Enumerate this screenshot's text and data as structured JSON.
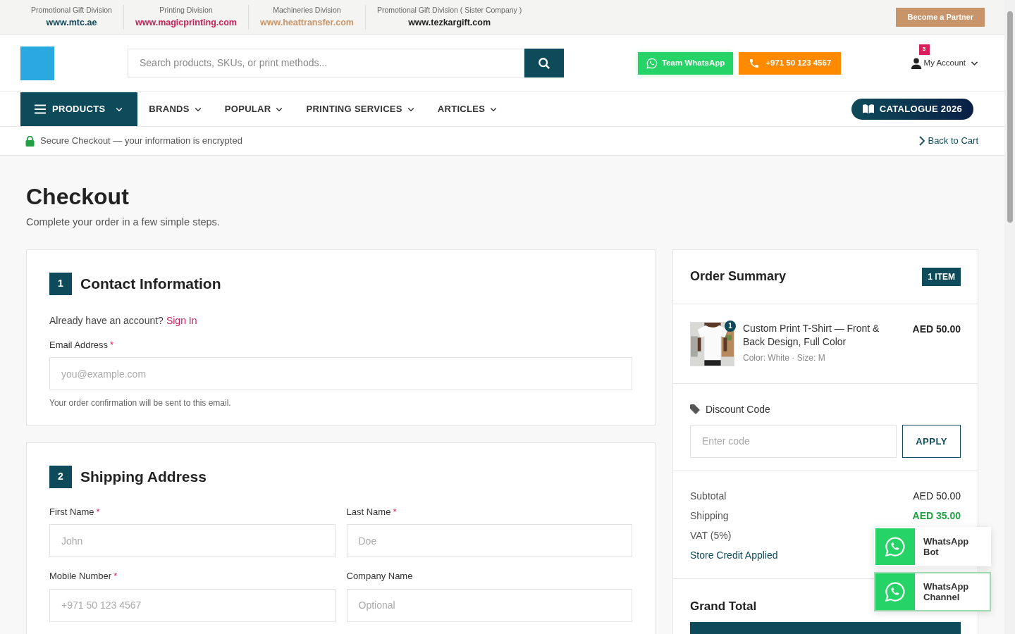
{
  "top_bar": {
    "divisions": [
      {
        "label": "Promotional Gift Division",
        "url": "www.mtc.ae",
        "color": "#144a5c"
      },
      {
        "label": "Printing Division",
        "url": "www.magicprinting.com",
        "color": "#c8205a"
      },
      {
        "label": "Machineries Division",
        "url": "www.heattransfer.com",
        "color": "#c8956a"
      },
      {
        "label": "Promotional Gift Division ( Sister Company )",
        "url": "www.tezkargift.com",
        "color": "#222222"
      }
    ],
    "partner_button": "Become a Partner"
  },
  "header": {
    "search": {
      "placeholder": "Search products, SKUs, or print methods..."
    },
    "whatsapp_button": "Team WhatsApp",
    "phone_button": "+971 50 123 4567",
    "account": {
      "label": "My Account",
      "badge": "5"
    }
  },
  "nav": {
    "items": [
      {
        "label": "PRODUCTS",
        "selected": true
      },
      {
        "label": "BRANDS",
        "selected": false
      },
      {
        "label": "POPULAR",
        "selected": false
      },
      {
        "label": "PRINTING SERVICES",
        "selected": false
      },
      {
        "label": "ARTICLES",
        "selected": false
      }
    ],
    "catalogue_button": "CATALOGUE 2026"
  },
  "secure_bar": {
    "text": "Secure Checkout — your information is encrypted",
    "back_link": "Back to Cart"
  },
  "page": {
    "title": "Checkout",
    "subtitle": "Complete your order in a few simple steps."
  },
  "contact": {
    "number": "1",
    "title": "Contact Information",
    "prompt": "Already have an account?",
    "sign_in": "Sign In",
    "email": {
      "label": "Email Address",
      "required_mark": "*",
      "placeholder": "you@example.com",
      "hint": "Your order confirmation will be sent to this email."
    }
  },
  "shipping": {
    "number": "2",
    "title": "Shipping Address",
    "fields": [
      {
        "label": "First Name",
        "required_mark": "*",
        "placeholder": "John"
      },
      {
        "label": "Last Name",
        "required_mark": "*",
        "placeholder": "Doe"
      },
      {
        "label": "Mobile Number",
        "required_mark": "*",
        "placeholder": "+971 50 123 4567"
      },
      {
        "label": "Company Name",
        "placeholder": "Optional"
      }
    ]
  },
  "summary": {
    "title": "Order Summary",
    "badge": "1 ITEM",
    "item": {
      "kind": "picture",
      "quantity": "1",
      "name": "Custom Print T-Shirt — Front & Back Design, Full Color",
      "variant": "Color: White · Size: M",
      "price": "AED 50.00"
    },
    "discount": {
      "label": "Discount Code",
      "placeholder": "Enter code",
      "button": "APPLY"
    },
    "totals": [
      {
        "label": "Subtotal",
        "value": "AED 50.00"
      },
      {
        "label": "Shipping",
        "value": "AED 35.00",
        "highlight": true
      },
      {
        "label": "VAT (5%)"
      },
      {
        "label": "Store Credit Applied",
        "link": true
      }
    ],
    "grand_total": "Grand Total"
  },
  "floating": [
    {
      "label": "WhatsApp Bot",
      "selected": false
    },
    {
      "label": "WhatsApp Channel",
      "selected": true
    }
  ]
}
